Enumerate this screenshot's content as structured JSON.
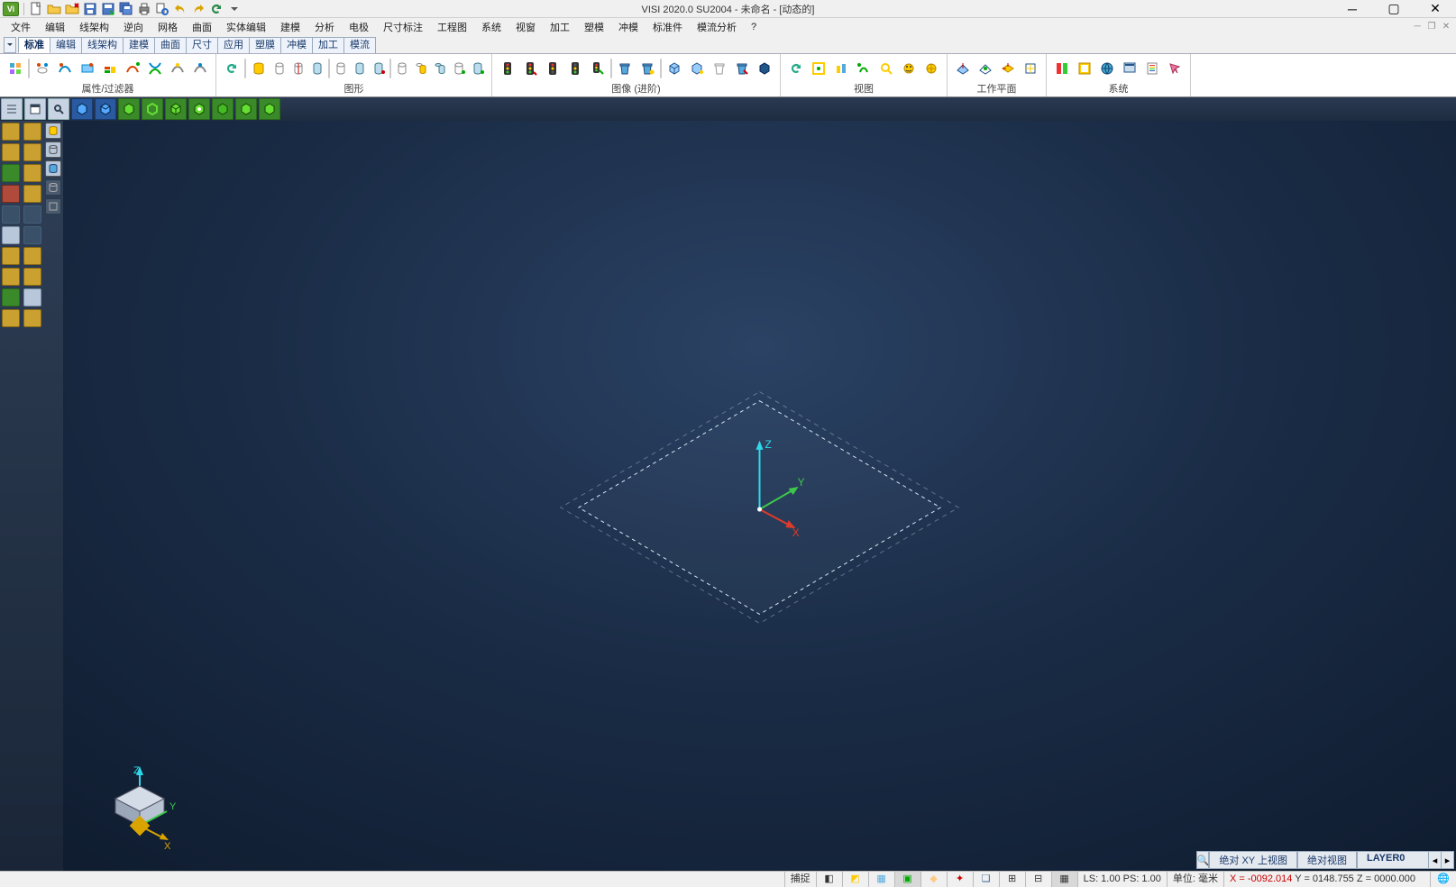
{
  "title": "VISI 2020.0 SU2004 - 未命名 - [动态的]",
  "menus": [
    "文件",
    "编辑",
    "线架构",
    "逆向",
    "网格",
    "曲面",
    "实体编辑",
    "建模",
    "分析",
    "电极",
    "尺寸标注",
    "工程图",
    "系统",
    "视窗",
    "加工",
    "塑模",
    "冲模",
    "标准件",
    "模流分析",
    "?"
  ],
  "tabs": [
    "标准",
    "编辑",
    "线架构",
    "建模",
    "曲面",
    "尺寸",
    "应用",
    "塑膜",
    "冲模",
    "加工",
    "模流"
  ],
  "active_tab": 0,
  "ribbon_groups": {
    "g1": "属性/过滤器",
    "g2": "图形",
    "g3": "图像 (进阶)",
    "g4": "视图",
    "g5": "工作平面",
    "g6": "系统"
  },
  "axes": {
    "x": "X",
    "y": "Y",
    "z": "Z"
  },
  "info": {
    "view1": "绝对 XY 上视图",
    "view2": "绝对视图",
    "layer": "LAYER0"
  },
  "status": {
    "snap": "捕捉",
    "ls": "LS: 1.00 PS: 1.00",
    "unit": "单位: 毫米",
    "coord_x": "X = -0092.014",
    "coord_yz": " Y = 0148.755 Z = 0000.000"
  }
}
